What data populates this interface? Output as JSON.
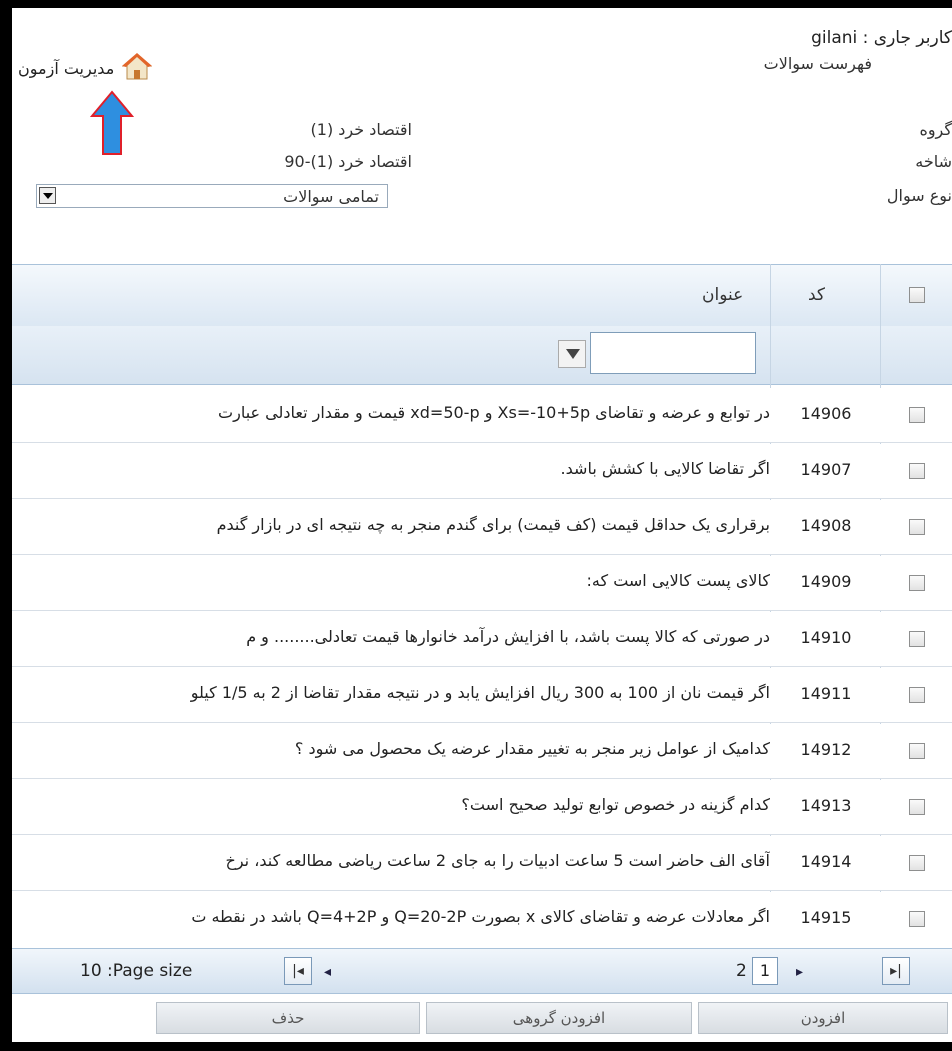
{
  "header": {
    "user_label": "کاربر جاری : gilani",
    "page_title": "فهرست سوالات",
    "manage_link": "مدیریت آزمون"
  },
  "form": {
    "group_label": "گروه",
    "group_value": "اقتصاد خرد (1)",
    "branch_label": "شاخه",
    "branch_value": "اقتصاد خرد (1)-90",
    "qtype_label": "نوع سوال",
    "qtype_value": "تمامی سوالات"
  },
  "grid": {
    "col_code": "کد",
    "col_title": "عنوان",
    "rows": [
      {
        "code": "14906",
        "title": "در توابع و عرضه و تقاضای Xs=-10+5p و xd=50-p قیمت و مقدار تعادلی عبارت"
      },
      {
        "code": "14907",
        "title": "اگر تقاضا کالایی با کشش باشد."
      },
      {
        "code": "14908",
        "title": "برقراری یک حداقل قیمت (کف قیمت) برای گندم منجر به چه نتیجه ای در بازار گندم"
      },
      {
        "code": "14909",
        "title": "کالای پست کالایی است که:"
      },
      {
        "code": "14910",
        "title": "در صورتی که کالا پست باشد، با افزایش درآمد خانوارها قیمت تعادلی........ و م"
      },
      {
        "code": "14911",
        "title": "اگر قیمت نان از 100 به 300 ریال افزایش یابد و در نتیجه مقدار تقاضا از 2 به 1/5 کیلو"
      },
      {
        "code": "14912",
        "title": "کدامیک از عوامل زیر منجر به تغییر مقدار عرضه یک محصول می شود ؟"
      },
      {
        "code": "14913",
        "title": "کدام گزینه در خصوص توابع تولید صحیح است؟"
      },
      {
        "code": "14914",
        "title": "آقای الف حاضر است 5 ساعت ادبیات را به جای 2 ساعت ریاضی مطالعه کند، نرخ"
      },
      {
        "code": "14915",
        "title": "اگر معادلات عرضه و تقاضای کالای x بصورت Q=20-2P و Q=4+2P باشد در نقطه ت"
      }
    ]
  },
  "pager": {
    "page_size_text": "10 :Page size",
    "current_page": "1",
    "total_pages": "2"
  },
  "actions": {
    "add": "افزودن",
    "add_group": "افزودن گروهی",
    "delete": "حذف"
  },
  "colors": {
    "arrow_fill": "#2e8fe0",
    "arrow_stroke": "#e0202a",
    "header_bg": "#dbe7f3"
  }
}
